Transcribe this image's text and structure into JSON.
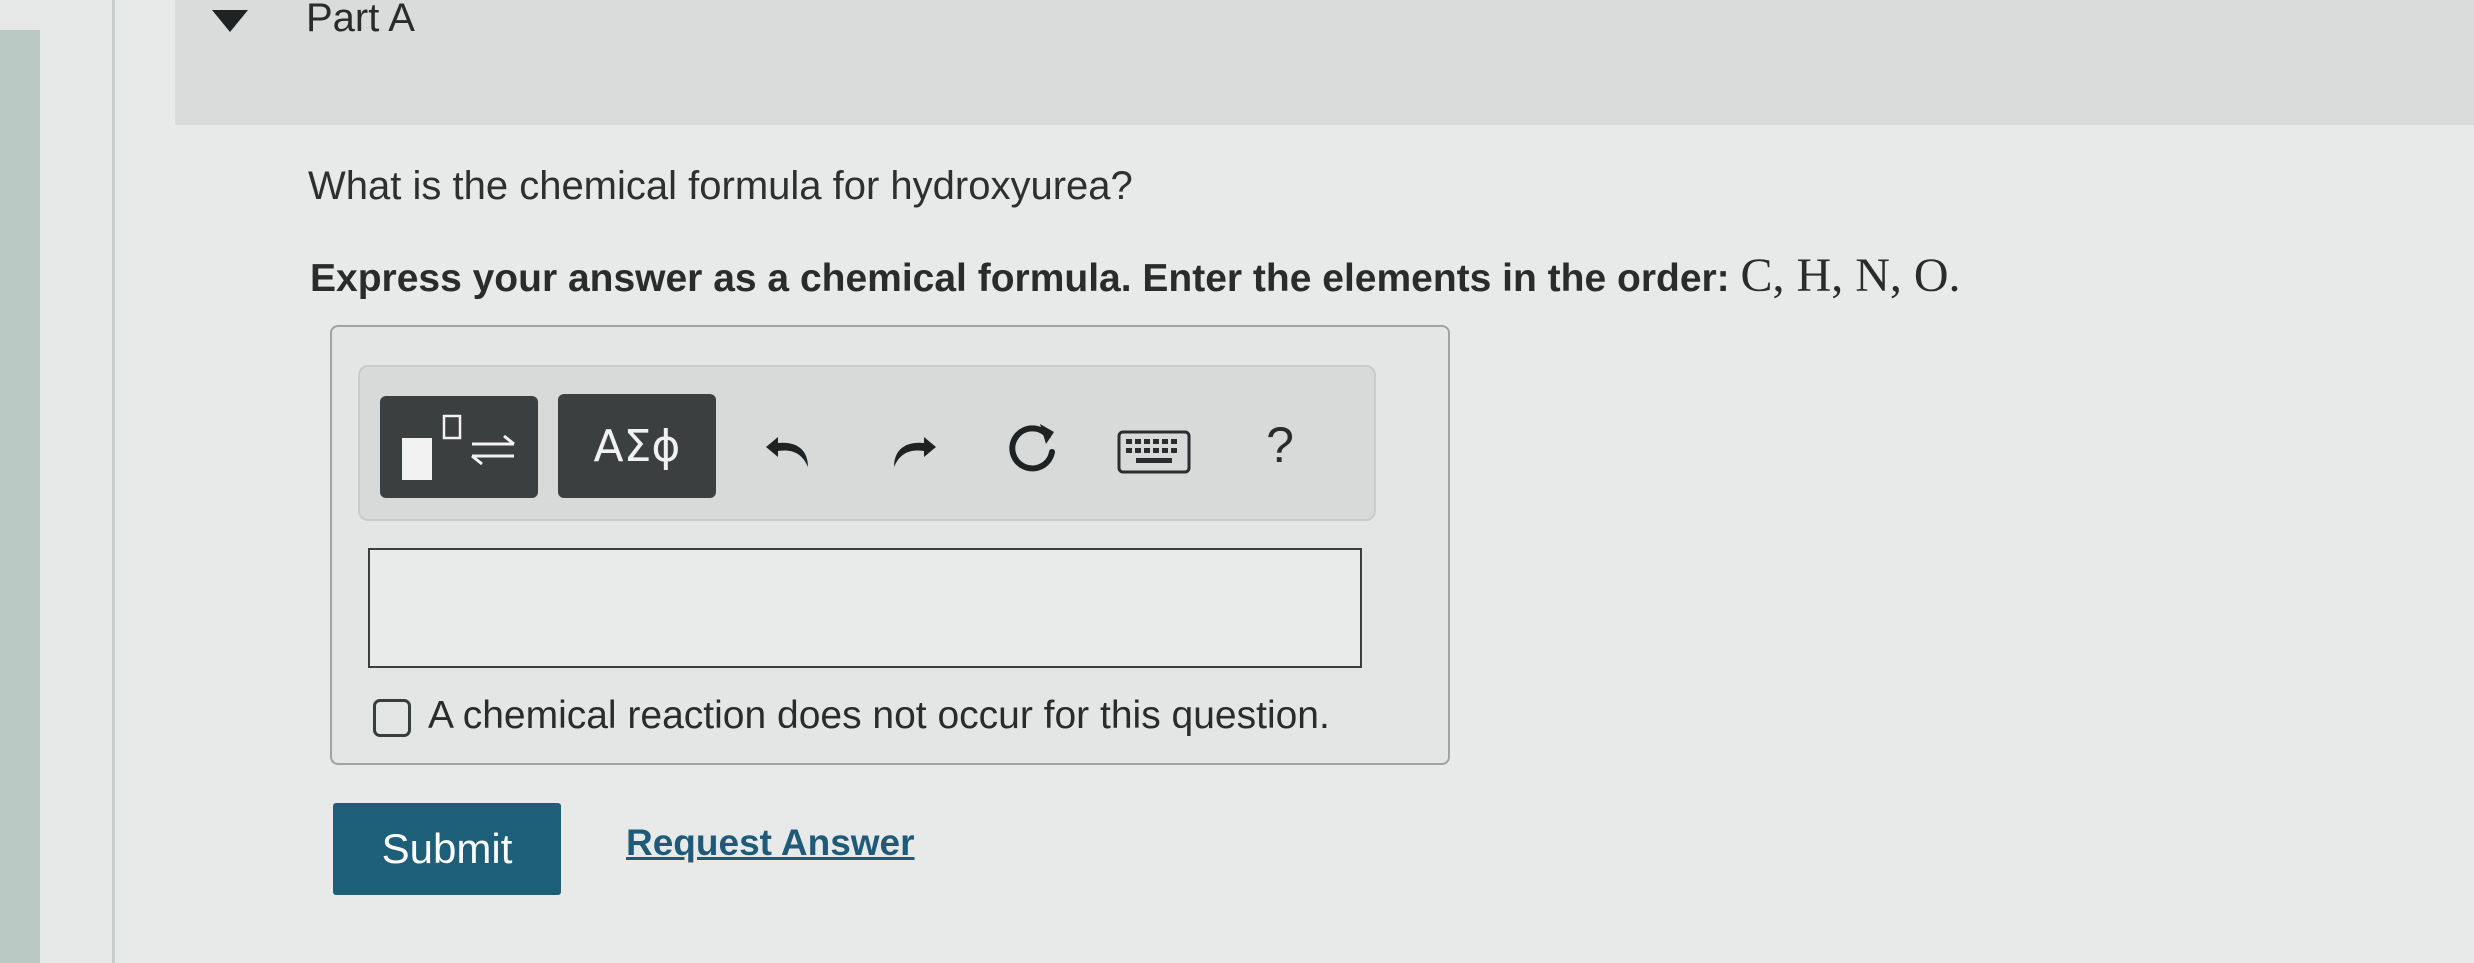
{
  "part": {
    "title": "Part A"
  },
  "question": {
    "text": "What is the chemical formula for hydroxyurea?",
    "instruction": "Express your answer as a chemical formula. Enter the elements in the order: ",
    "element_order": "C, H, N, O."
  },
  "toolbar": {
    "greek_label": "ΑΣϕ",
    "help_label": "?"
  },
  "answer": {
    "value": ""
  },
  "no_reaction": {
    "label": "A chemical reaction does not occur for this question.",
    "checked": false
  },
  "actions": {
    "submit_label": "Submit",
    "request_label": "Request Answer"
  },
  "colors": {
    "submit_bg": "#1d5f78",
    "link": "#1f5a78",
    "toolbar_button": "#3c3f40"
  }
}
